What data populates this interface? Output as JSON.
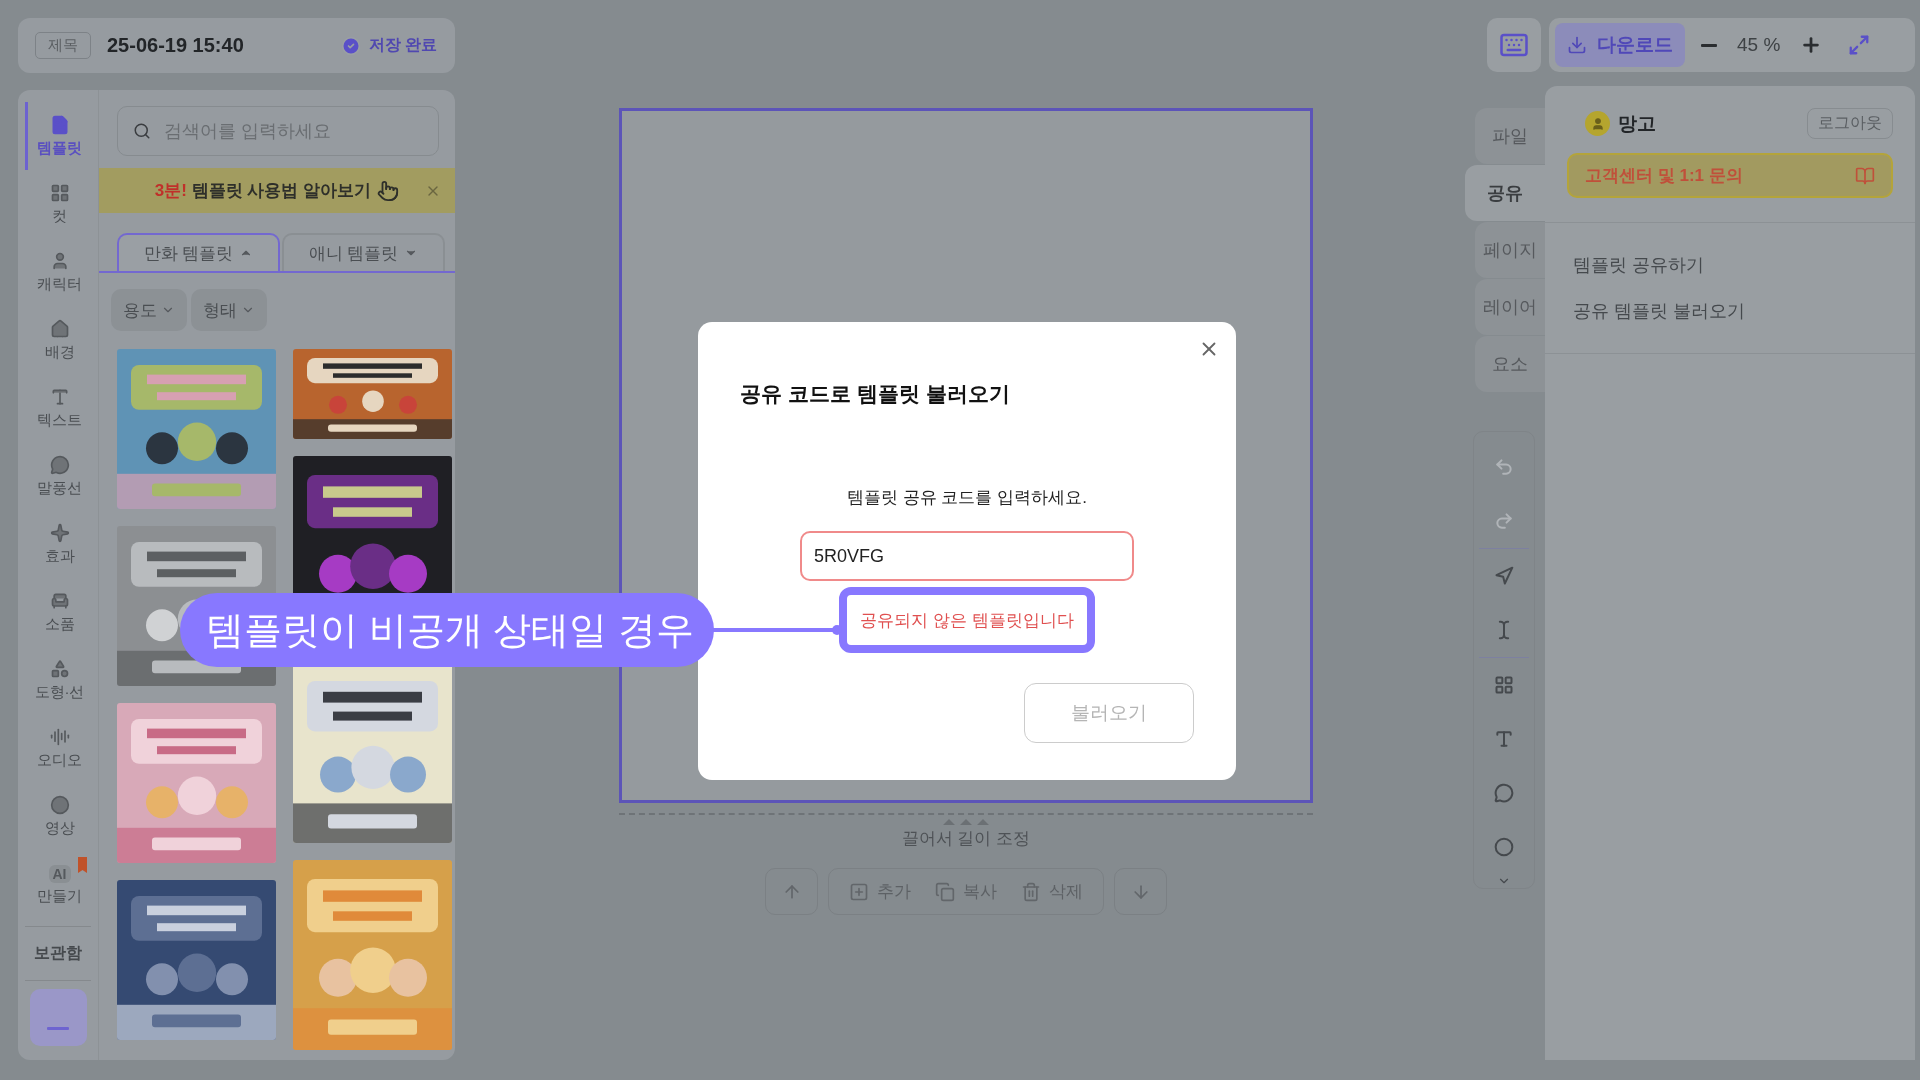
{
  "header": {
    "title_label": "제목",
    "title": "25-06-19 15:40",
    "save_status": "저장 완료"
  },
  "sidebar": {
    "items": [
      {
        "kind": "template",
        "label": "템플릿",
        "selected": true
      },
      {
        "kind": "cut",
        "label": "컷",
        "selected": false
      },
      {
        "kind": "character",
        "label": "캐릭터",
        "selected": false
      },
      {
        "kind": "background",
        "label": "배경",
        "selected": false
      },
      {
        "kind": "text",
        "label": "텍스트",
        "selected": false
      },
      {
        "kind": "bubble",
        "label": "말풍선",
        "selected": false
      },
      {
        "kind": "effect",
        "label": "효과",
        "selected": false
      },
      {
        "kind": "prop",
        "label": "소품",
        "selected": false
      },
      {
        "kind": "shape",
        "label": "도형·선",
        "selected": false
      },
      {
        "kind": "audio",
        "label": "오디오",
        "selected": false
      },
      {
        "kind": "video",
        "label": "영상",
        "selected": false
      },
      {
        "kind": "ai",
        "label": "만들기",
        "icon_text": "AI",
        "selected": false
      }
    ],
    "storage": "보관함"
  },
  "template_panel": {
    "search": {
      "placeholder": "검색어를 입력하세요"
    },
    "banner": {
      "highlight": "3분!",
      "text": "템플릿 사용법 알아보기"
    },
    "tabs": [
      {
        "label": "만화 템플릿",
        "selected": true
      },
      {
        "label": "애니 템플릿",
        "selected": false
      }
    ],
    "filters": [
      "용도",
      "형태"
    ],
    "templates": [
      {
        "kind": "picture"
      },
      {
        "kind": "picture"
      },
      {
        "kind": "picture"
      },
      {
        "kind": "picture"
      },
      {
        "kind": "picture"
      },
      {
        "kind": "picture"
      },
      {
        "kind": "picture"
      },
      {
        "kind": "picture"
      }
    ]
  },
  "toolbar": {
    "download": "다운로드",
    "zoom": "45 %"
  },
  "side_tabs": [
    {
      "label": "파일",
      "selected": false
    },
    {
      "label": "공유",
      "selected": true
    },
    {
      "label": "페이지",
      "selected": false
    },
    {
      "label": "레이어",
      "selected": false
    },
    {
      "label": "요소",
      "selected": false
    }
  ],
  "account_panel": {
    "user": "망고",
    "logout": "로그아웃",
    "support": "고객센터 및 1:1 문의",
    "menu": [
      "템플릿 공유하기",
      "공유 템플릿 불러오기"
    ]
  },
  "tools": [
    {
      "kind": "undo",
      "disabled": true
    },
    {
      "kind": "redo",
      "disabled": true
    },
    {
      "kind": "select",
      "disabled": false
    },
    {
      "kind": "text-cursor",
      "disabled": false
    },
    {
      "kind": "cut",
      "disabled": false
    },
    {
      "kind": "text",
      "disabled": false
    },
    {
      "kind": "bubble",
      "disabled": false
    },
    {
      "kind": "circle",
      "disabled": false
    }
  ],
  "canvas": {
    "resize_hint": "끌어서 길이 조정",
    "actions": [
      {
        "kind": "add",
        "label": "추가"
      },
      {
        "kind": "copy",
        "label": "복사"
      },
      {
        "kind": "delete",
        "label": "삭제"
      }
    ]
  },
  "dialog": {
    "title": "공유 코드로 템플릿 불러오기",
    "prompt": "템플릿 공유 코드를 입력하세요.",
    "code": "5R0VFG",
    "error": "공유되지 않은 템플릿입니다",
    "submit": {
      "label": "불러오기",
      "disabled": true
    }
  },
  "callout": {
    "text": "템플릿이 비공개 상태일 경우"
  }
}
